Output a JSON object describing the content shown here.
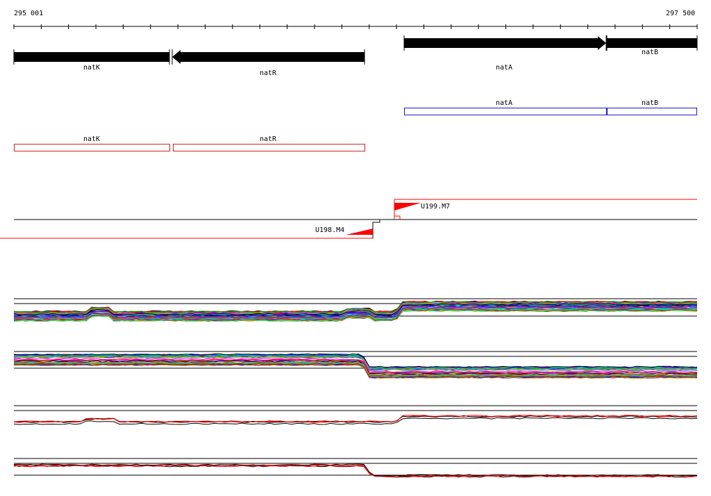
{
  "ruler": {
    "start_label": "295 001",
    "end_label": "297 500"
  },
  "genes": [
    {
      "name": "natK",
      "strand": "-"
    },
    {
      "name": "natR",
      "strand": "-"
    },
    {
      "name": "natA",
      "strand": "+"
    },
    {
      "name": "natB",
      "strand": "+"
    }
  ],
  "blue_features": [
    {
      "name": "natA"
    },
    {
      "name": "natB"
    }
  ],
  "red_features": [
    {
      "name": "natK"
    },
    {
      "name": "natR"
    }
  ],
  "terminators": [
    {
      "name": "U198.M4"
    },
    {
      "name": "U199.M7"
    }
  ],
  "colors": {
    "gene_arrow": "#000000",
    "blue_feature": "#1a1acc",
    "red_feature": "#cc2222",
    "terminator": "#ff0000",
    "trace_palette": [
      "#ff0000",
      "#00aa00",
      "#0000ff",
      "#ff00ff",
      "#00cccc",
      "#aaaa00",
      "#ff8800",
      "#8800ff",
      "#00ff66",
      "#888888",
      "#663300",
      "#0088ff"
    ]
  }
}
